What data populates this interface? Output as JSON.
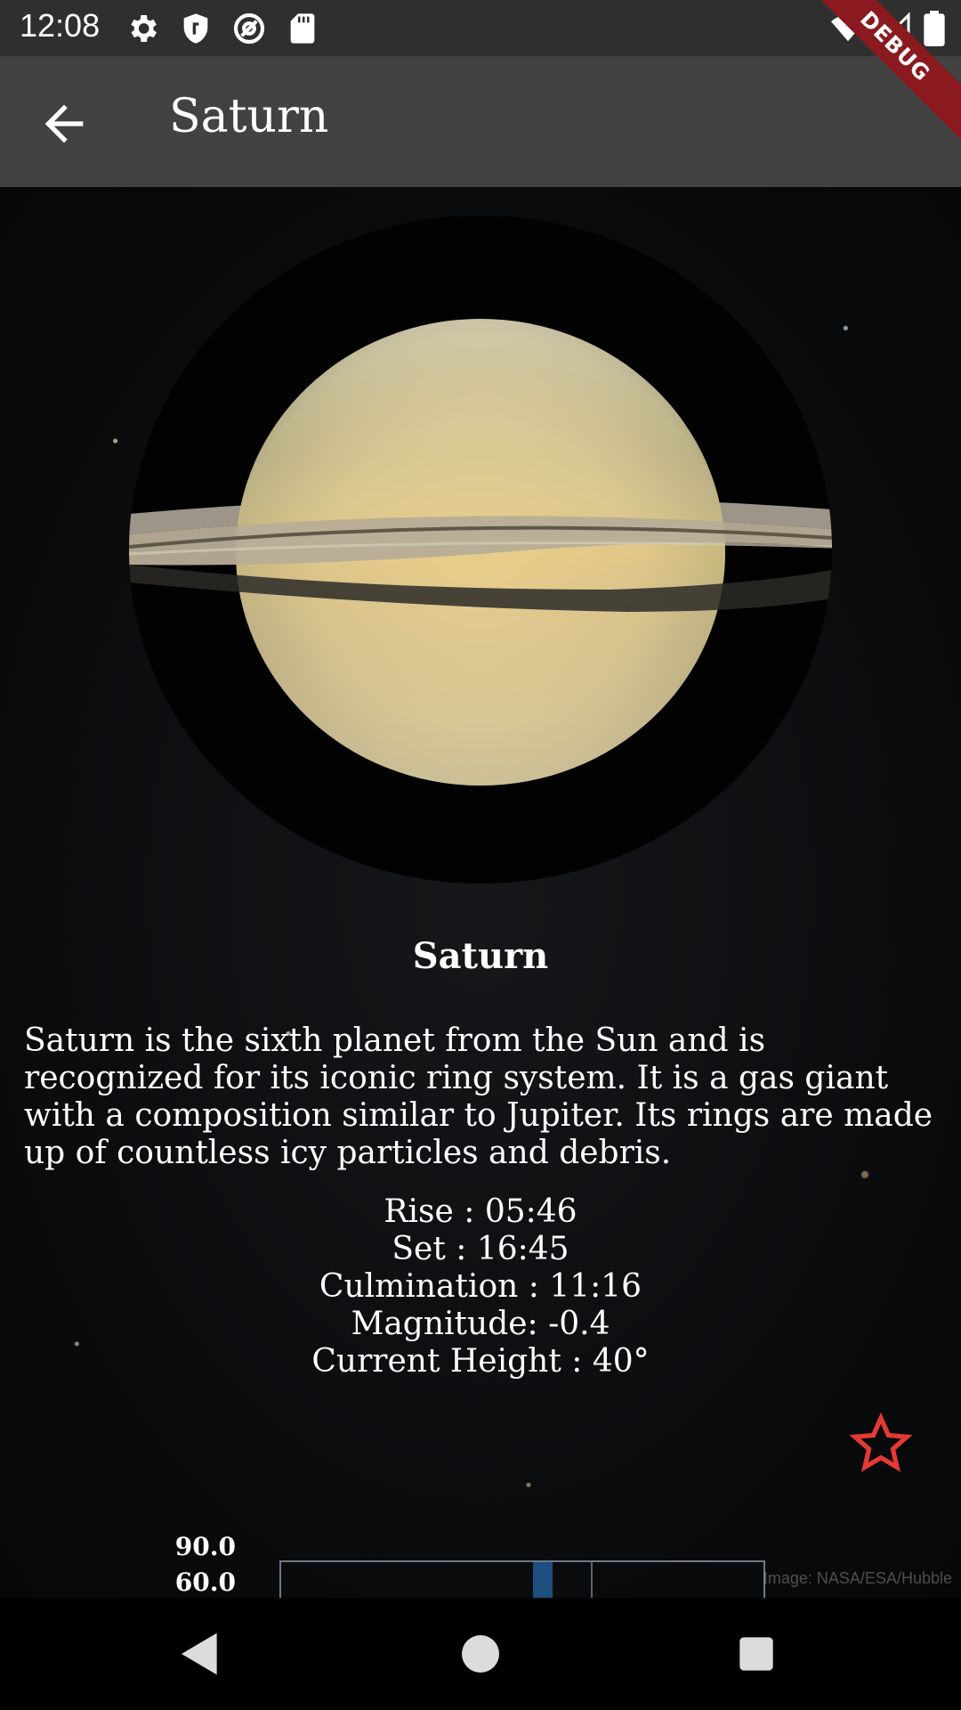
{
  "status_bar": {
    "time": "12:08",
    "icons": [
      "gear-icon",
      "shield-icon",
      "at-sign-icon",
      "sd-card-icon",
      "wifi-icon",
      "signal-icon",
      "battery-icon"
    ],
    "debug_label": "DEBUG"
  },
  "app_bar": {
    "title": "Saturn",
    "back_icon": "arrow-left-icon"
  },
  "planet": {
    "name": "Saturn",
    "description": "Saturn is the sixth planet from the Sun and is recognized for its iconic ring system. It is a gas giant with a composition similar to Jupiter. Its rings are made up of countless icy particles and debris.",
    "rise": "Rise : 05:46",
    "set": "Set : 16:45",
    "culmination": "Culmination : 11:16",
    "magnitude": "Magnitude: -0.4",
    "current_height": "Current Height : 40°"
  },
  "favorite": {
    "icon": "star-outline-icon",
    "color": "#e53935"
  },
  "chart": {
    "y_ticks": [
      "90.0",
      "60.0"
    ]
  },
  "image_credit": "Image: NASA/ESA/Hubble",
  "nav_bar": {
    "icons": [
      "back-triangle-icon",
      "home-circle-icon",
      "recents-square-icon"
    ]
  }
}
